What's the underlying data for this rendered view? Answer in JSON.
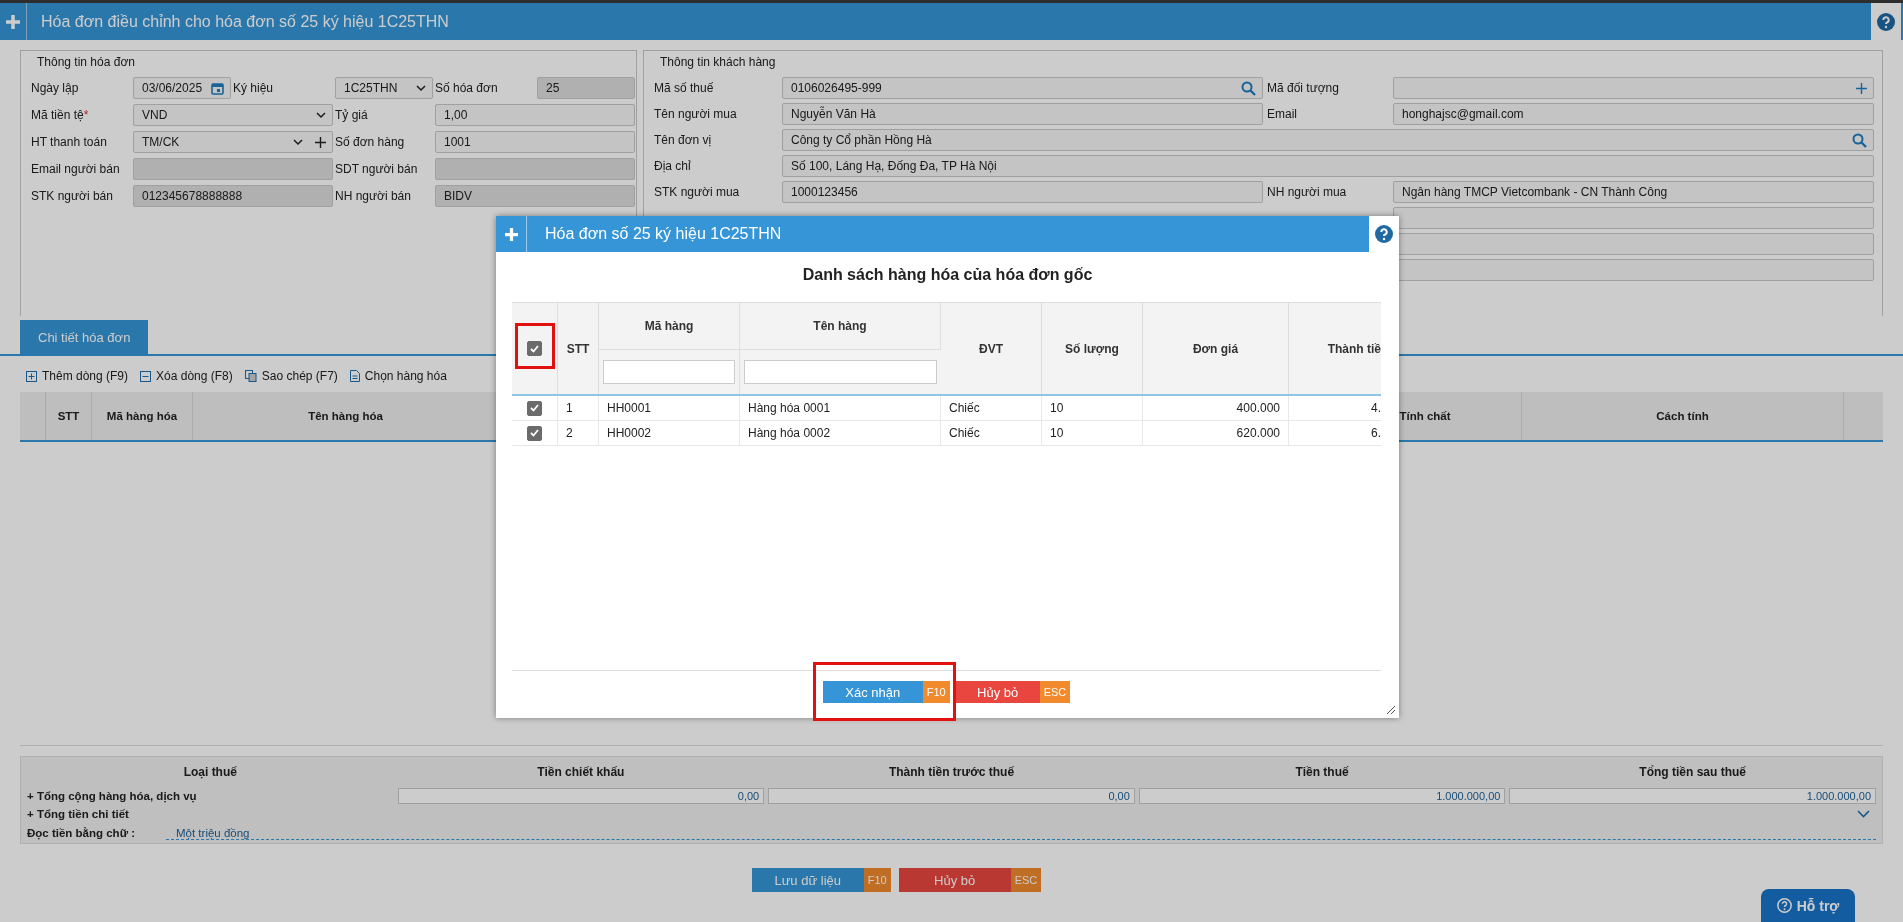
{
  "window": {
    "title": "Hóa đơn điều chỉnh cho hóa đơn số 25 ký hiệu 1C25THN"
  },
  "invoice_info": {
    "legend": "Thông tin hóa đơn",
    "rows": [
      {
        "fields": [
          {
            "label": "Ngày lập",
            "value": "03/06/2025",
            "kind": "date"
          },
          {
            "label": "Ký hiệu",
            "value": "1C25THN",
            "kind": "select"
          },
          {
            "label": "Số hóa đơn",
            "value": "25",
            "kind": "readonly"
          }
        ]
      },
      {
        "fields": [
          {
            "label": "Mã tiền tệ",
            "required_mark": "*",
            "value": "VND",
            "kind": "select"
          },
          {
            "label": "Tỷ giá",
            "value": "1,00",
            "kind": "text"
          }
        ]
      },
      {
        "fields": [
          {
            "label": "HT thanh toán",
            "value": "TM/CK",
            "kind": "select_add"
          },
          {
            "label": "Số đơn hàng",
            "value": "1001",
            "kind": "text"
          }
        ]
      },
      {
        "fields": [
          {
            "label": "Email người bán",
            "kind": "readonly"
          },
          {
            "label": "SDT người bán",
            "kind": "readonly"
          }
        ]
      },
      {
        "fields": [
          {
            "label": "STK người bán",
            "value": "012345678888888",
            "kind": "readonly"
          },
          {
            "label": "NH người bán",
            "value": "BIDV",
            "kind": "readonly"
          }
        ]
      }
    ]
  },
  "customer_info": {
    "legend": "Thông tin khách hàng",
    "rows": [
      {
        "kind": "pair",
        "fields": [
          {
            "label": "Mã số thuế",
            "value": "0106026495-999",
            "kind": "search"
          },
          {
            "label": "Mã đối tượng",
            "kind": "add"
          }
        ]
      },
      {
        "kind": "pair",
        "fields": [
          {
            "label": "Tên người mua",
            "value": "Nguyễn Văn Hà",
            "kind": "text"
          },
          {
            "label": "Email",
            "value": "honghajsc@gmail.com",
            "kind": "text"
          }
        ]
      },
      {
        "kind": "wide",
        "fields": [
          {
            "label": "Tên đơn vị",
            "value": "Công ty Cổ phần Hồng Hà",
            "kind": "search"
          }
        ]
      },
      {
        "kind": "wide",
        "fields": [
          {
            "label": "Địa chỉ",
            "value": "Số 100, Láng Hạ, Đống Đa, TP Hà Nội",
            "kind": "text"
          }
        ]
      },
      {
        "kind": "pair",
        "fields": [
          {
            "label": "STK người mua",
            "value": "1000123456",
            "kind": "text"
          },
          {
            "label": "NH người mua",
            "value": "Ngân hàng TMCP Vietcombank - CN Thành Công",
            "kind": "text"
          }
        ]
      },
      {
        "kind": "right",
        "fields": [
          {
            "kind": "text"
          }
        ]
      },
      {
        "kind": "right",
        "fields": [
          {
            "kind": "text"
          }
        ]
      },
      {
        "kind": "right",
        "fields": [
          {
            "kind": "text"
          }
        ]
      }
    ]
  },
  "tabs": [
    {
      "label": "Chi tiết hóa đơn",
      "selected": true
    }
  ],
  "toolbar": [
    {
      "label": "Thêm dòng (F9)",
      "kind": "add"
    },
    {
      "label": "Xóa dòng (F8)",
      "kind": "remove"
    },
    {
      "label": "Sao chép (F7)",
      "kind": "copy"
    },
    {
      "label": "Chọn hàng hóa",
      "kind": "file"
    }
  ],
  "detail_table": {
    "columns": [
      {
        "label": "STT",
        "kind": "stt"
      },
      {
        "label": "Mã hàng hóa",
        "kind": "code"
      },
      {
        "label": "Tên hàng hóa",
        "kind": "name"
      },
      {
        "label": "Tính chất",
        "kind": "property"
      },
      {
        "label": "Cách tính",
        "kind": "method"
      }
    ]
  },
  "summary": {
    "columns": [
      "Loại thuế",
      "Tiền chiết khấu",
      "Thành tiền trước thuế",
      "Tiền thuế",
      "Tổng tiền sau thuế"
    ],
    "total_row": {
      "label": "+ Tổng cộng hàng hóa, dịch vụ",
      "values": [
        "0,00",
        "0,00",
        "1.000.000,00",
        "1.000.000,00"
      ]
    },
    "detail_row": {
      "label": "+ Tổng tiền chi tiết",
      "expanded": false
    },
    "words_row": {
      "label": "Đọc tiền bằng chữ :",
      "value": "Một triệu đồng"
    }
  },
  "buttons": [
    {
      "label": "Lưu dữ liệu",
      "key": "F10",
      "kind": "primary"
    },
    {
      "label": "Hủy bỏ",
      "key": "ESC",
      "kind": "danger"
    }
  ],
  "help_button": {
    "label": "Hỗ trợ"
  },
  "modal": {
    "title": "Hóa đơn số 25 ký hiệu 1C25THN",
    "heading": "Danh sách hàng hóa của hóa đơn gốc",
    "select_all": {
      "checked": true
    },
    "columns": [
      {
        "label": "STT",
        "kind": "stt"
      },
      {
        "label": "Mã hàng",
        "kind": "filter"
      },
      {
        "label": "Tên hàng",
        "kind": "filter"
      },
      {
        "label": "ĐVT",
        "kind": "plain"
      },
      {
        "label": "Số lượng",
        "kind": "plain"
      },
      {
        "label": "Đơn giá",
        "kind": "plain"
      },
      {
        "label": "Thành tiề",
        "kind": "plain"
      }
    ],
    "rows": [
      {
        "checked": true,
        "cells": [
          "1",
          "HH0001",
          "Hàng hóa 0001",
          "Chiếc",
          "10",
          "400.000",
          "4."
        ]
      },
      {
        "checked": true,
        "cells": [
          "2",
          "HH0002",
          "Hàng hóa 0002",
          "Chiếc",
          "10",
          "620.000",
          "6."
        ]
      }
    ],
    "buttons": [
      {
        "label": "Xác nhận",
        "key": "F10",
        "kind": "primary"
      },
      {
        "label": "Hủy bỏ",
        "key": "ESC",
        "kind": "danger"
      }
    ]
  }
}
